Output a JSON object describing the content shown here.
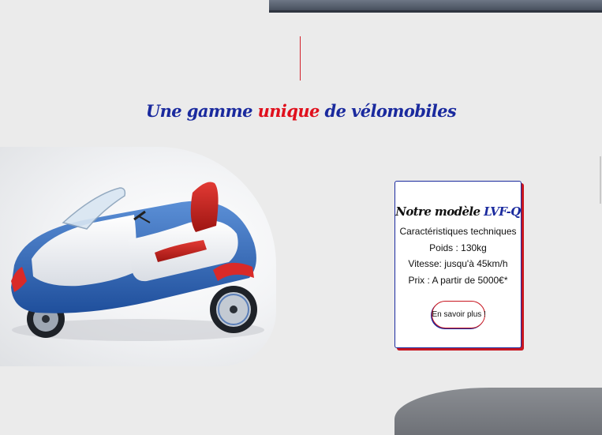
{
  "section": {
    "heading_part1": "Une gamme",
    "heading_accent": "unique",
    "heading_part2": "de vélomobiles"
  },
  "card": {
    "title_prefix": "Notre modèle",
    "model_name": "LVF-Q",
    "subtitle": "Caractéristiques techniques",
    "weight": "Poids : 130kg",
    "speed": "Vitesse: jusqu'à 45km/h",
    "price": "Prix : A partir de 5000€*",
    "cta_label": "En savoir plus !"
  },
  "colors": {
    "brand_blue": "#1a2a9e",
    "brand_red": "#e0101d",
    "background": "#ebebeb"
  }
}
